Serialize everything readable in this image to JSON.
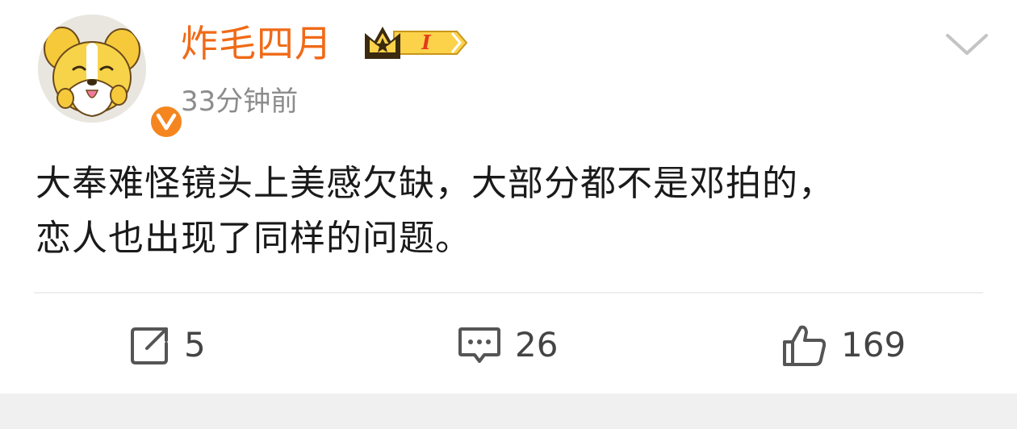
{
  "post": {
    "author": {
      "name": "炸毛四月",
      "avatar_icon": "dog-avatar-icon",
      "verified_icon": "verified-v-icon",
      "vip_badge_icon": "crown-vip-badge-icon",
      "vip_level": "I"
    },
    "timestamp": "33分钟前",
    "text": "大奉难怪镜头上美感欠缺，大部分都不是邓拍的，\n恋人也出现了同样的问题。"
  },
  "actions": {
    "repost": {
      "icon": "repost-icon",
      "count": "5"
    },
    "comment": {
      "icon": "comment-icon",
      "count": "26"
    },
    "like": {
      "icon": "thumbs-up-icon",
      "count": "169"
    }
  },
  "colors": {
    "username": "#f06a17",
    "verified_badge": "#f5861f",
    "timestamp": "#8c8c8c",
    "text": "#1a1a1a",
    "icon": "#555555"
  }
}
